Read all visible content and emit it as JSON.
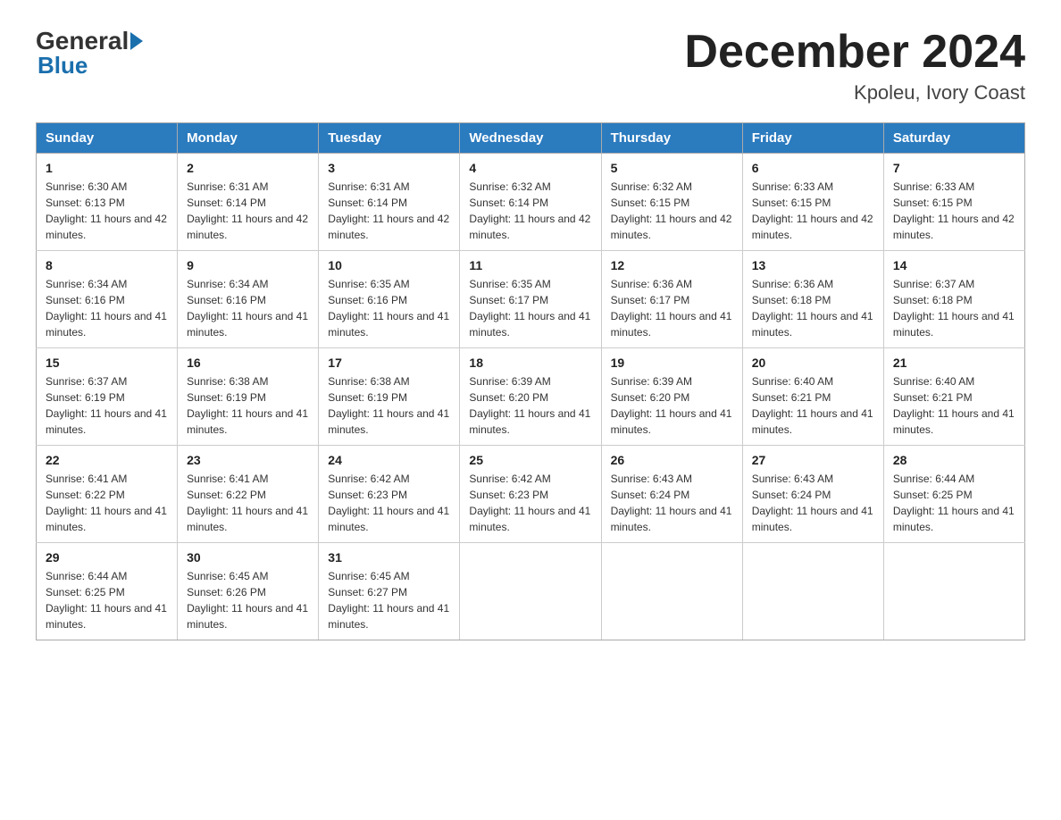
{
  "logo": {
    "general": "General",
    "blue": "Blue"
  },
  "title": "December 2024",
  "subtitle": "Kpoleu, Ivory Coast",
  "days_of_week": [
    "Sunday",
    "Monday",
    "Tuesday",
    "Wednesday",
    "Thursday",
    "Friday",
    "Saturday"
  ],
  "weeks": [
    [
      {
        "day": "1",
        "sunrise": "6:30 AM",
        "sunset": "6:13 PM",
        "daylight": "11 hours and 42 minutes."
      },
      {
        "day": "2",
        "sunrise": "6:31 AM",
        "sunset": "6:14 PM",
        "daylight": "11 hours and 42 minutes."
      },
      {
        "day": "3",
        "sunrise": "6:31 AM",
        "sunset": "6:14 PM",
        "daylight": "11 hours and 42 minutes."
      },
      {
        "day": "4",
        "sunrise": "6:32 AM",
        "sunset": "6:14 PM",
        "daylight": "11 hours and 42 minutes."
      },
      {
        "day": "5",
        "sunrise": "6:32 AM",
        "sunset": "6:15 PM",
        "daylight": "11 hours and 42 minutes."
      },
      {
        "day": "6",
        "sunrise": "6:33 AM",
        "sunset": "6:15 PM",
        "daylight": "11 hours and 42 minutes."
      },
      {
        "day": "7",
        "sunrise": "6:33 AM",
        "sunset": "6:15 PM",
        "daylight": "11 hours and 42 minutes."
      }
    ],
    [
      {
        "day": "8",
        "sunrise": "6:34 AM",
        "sunset": "6:16 PM",
        "daylight": "11 hours and 41 minutes."
      },
      {
        "day": "9",
        "sunrise": "6:34 AM",
        "sunset": "6:16 PM",
        "daylight": "11 hours and 41 minutes."
      },
      {
        "day": "10",
        "sunrise": "6:35 AM",
        "sunset": "6:16 PM",
        "daylight": "11 hours and 41 minutes."
      },
      {
        "day": "11",
        "sunrise": "6:35 AM",
        "sunset": "6:17 PM",
        "daylight": "11 hours and 41 minutes."
      },
      {
        "day": "12",
        "sunrise": "6:36 AM",
        "sunset": "6:17 PM",
        "daylight": "11 hours and 41 minutes."
      },
      {
        "day": "13",
        "sunrise": "6:36 AM",
        "sunset": "6:18 PM",
        "daylight": "11 hours and 41 minutes."
      },
      {
        "day": "14",
        "sunrise": "6:37 AM",
        "sunset": "6:18 PM",
        "daylight": "11 hours and 41 minutes."
      }
    ],
    [
      {
        "day": "15",
        "sunrise": "6:37 AM",
        "sunset": "6:19 PM",
        "daylight": "11 hours and 41 minutes."
      },
      {
        "day": "16",
        "sunrise": "6:38 AM",
        "sunset": "6:19 PM",
        "daylight": "11 hours and 41 minutes."
      },
      {
        "day": "17",
        "sunrise": "6:38 AM",
        "sunset": "6:19 PM",
        "daylight": "11 hours and 41 minutes."
      },
      {
        "day": "18",
        "sunrise": "6:39 AM",
        "sunset": "6:20 PM",
        "daylight": "11 hours and 41 minutes."
      },
      {
        "day": "19",
        "sunrise": "6:39 AM",
        "sunset": "6:20 PM",
        "daylight": "11 hours and 41 minutes."
      },
      {
        "day": "20",
        "sunrise": "6:40 AM",
        "sunset": "6:21 PM",
        "daylight": "11 hours and 41 minutes."
      },
      {
        "day": "21",
        "sunrise": "6:40 AM",
        "sunset": "6:21 PM",
        "daylight": "11 hours and 41 minutes."
      }
    ],
    [
      {
        "day": "22",
        "sunrise": "6:41 AM",
        "sunset": "6:22 PM",
        "daylight": "11 hours and 41 minutes."
      },
      {
        "day": "23",
        "sunrise": "6:41 AM",
        "sunset": "6:22 PM",
        "daylight": "11 hours and 41 minutes."
      },
      {
        "day": "24",
        "sunrise": "6:42 AM",
        "sunset": "6:23 PM",
        "daylight": "11 hours and 41 minutes."
      },
      {
        "day": "25",
        "sunrise": "6:42 AM",
        "sunset": "6:23 PM",
        "daylight": "11 hours and 41 minutes."
      },
      {
        "day": "26",
        "sunrise": "6:43 AM",
        "sunset": "6:24 PM",
        "daylight": "11 hours and 41 minutes."
      },
      {
        "day": "27",
        "sunrise": "6:43 AM",
        "sunset": "6:24 PM",
        "daylight": "11 hours and 41 minutes."
      },
      {
        "day": "28",
        "sunrise": "6:44 AM",
        "sunset": "6:25 PM",
        "daylight": "11 hours and 41 minutes."
      }
    ],
    [
      {
        "day": "29",
        "sunrise": "6:44 AM",
        "sunset": "6:25 PM",
        "daylight": "11 hours and 41 minutes."
      },
      {
        "day": "30",
        "sunrise": "6:45 AM",
        "sunset": "6:26 PM",
        "daylight": "11 hours and 41 minutes."
      },
      {
        "day": "31",
        "sunrise": "6:45 AM",
        "sunset": "6:27 PM",
        "daylight": "11 hours and 41 minutes."
      },
      null,
      null,
      null,
      null
    ]
  ]
}
